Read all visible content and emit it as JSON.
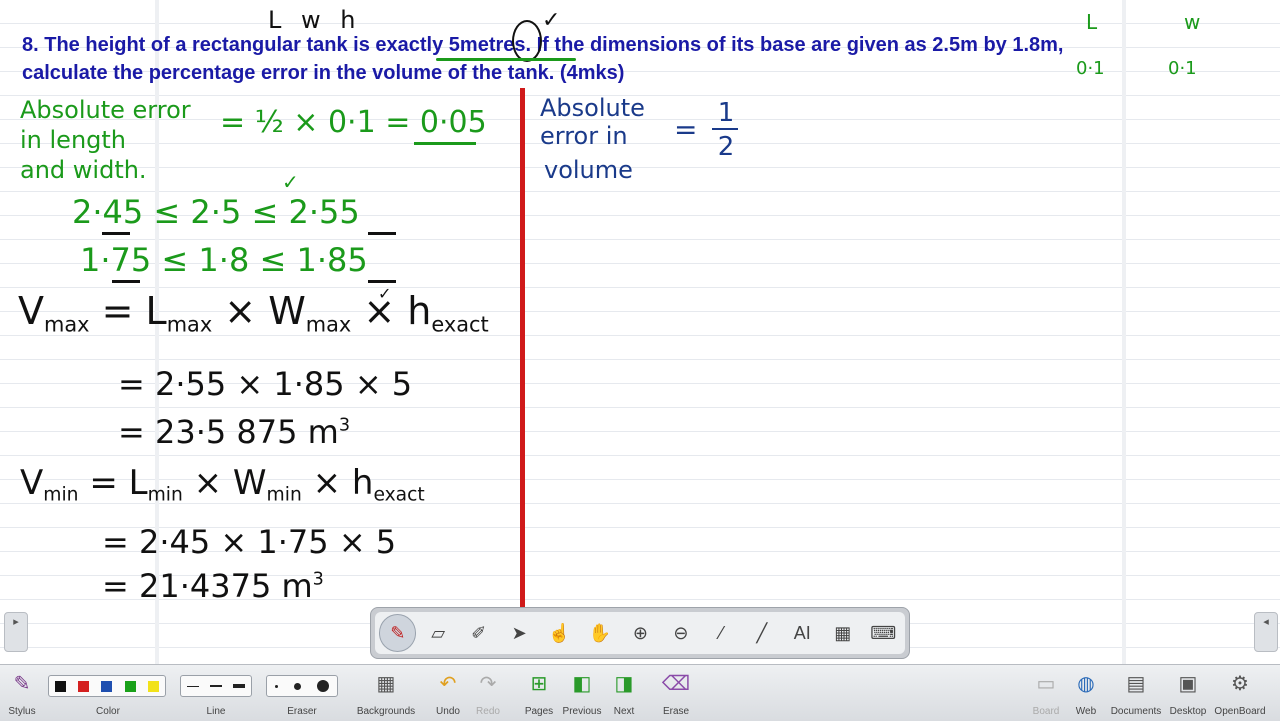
{
  "question": {
    "line1": "8. The height of a rectangular tank is exactly 5metres. If the dimensions of its base are given as 2.5m by 1.8m,",
    "line2": "calculate the percentage error in the volume of the tank. (4mks)"
  },
  "annotations": {
    "lwh": "L w h",
    "L": "L",
    "w": "w",
    "l_err": "0·1",
    "w_err": "0·1",
    "tick": "✓"
  },
  "left_work": {
    "abs_err_label_1": "Absolute error",
    "abs_err_label_2": "in length",
    "abs_err_label_3": "and width.",
    "abs_err_calc_a": "= ",
    "abs_err_half": "½",
    "abs_err_calc_b": " × 0·1 = 0·05",
    "bound_len": "2·45  ≤ 2·5 ≤ 2·55",
    "bound_wid": "1·75  ≤ 1·8 ≤ 1·85",
    "vmax_V": "V",
    "vmax_sub": "max",
    "vmax_eq": " = L",
    "vmax_Lsub": "max",
    "vmax_x1": " × W",
    "vmax_Wsub": "max",
    "vmax_x2": " × h",
    "vmax_hsub": "exact",
    "vmax_step1": "= 2·55 × 1·85 × 5",
    "vmax_step2": "= 23·5 875 m",
    "vmin_V": "V",
    "vmin_sub": "min",
    "vmin_eq": " = L",
    "vmin_Lsub": "min",
    "vmin_x1": " × W",
    "vmin_Wsub": "min",
    "vmin_x2": " × h",
    "vmin_hsub": "exact",
    "vmin_step1": "= 2·45 × 1·75 × 5",
    "vmin_step2": "= 21·4375 m",
    "cube": "3"
  },
  "right_work": {
    "label_1": "Absolute",
    "label_2": "error in",
    "label_3": "volume",
    "eq": "=",
    "num": "1",
    "den": "2"
  },
  "side_tabs": {
    "left": "▸",
    "right": "◂"
  },
  "colors": {
    "question": "#1a1aa6",
    "green_ink": "#1b9a1b",
    "black_ink": "#111111",
    "blue_ink": "#1a3a8a",
    "divider": "#d01a1a"
  },
  "floating_toolbar": {
    "tools": [
      {
        "icon": "pen-icon",
        "glyph": "✎"
      },
      {
        "icon": "eraser-icon",
        "glyph": "▱"
      },
      {
        "icon": "highlighter-icon",
        "glyph": "✐"
      },
      {
        "icon": "pointer-icon",
        "glyph": "➤"
      },
      {
        "icon": "laser-hand-icon",
        "glyph": "☝"
      },
      {
        "icon": "hand-icon",
        "glyph": "✋"
      },
      {
        "icon": "zoom-in-icon",
        "glyph": "⊕"
      },
      {
        "icon": "zoom-out-icon",
        "glyph": "⊖"
      },
      {
        "icon": "laser-pointer-icon",
        "glyph": "⁄"
      },
      {
        "icon": "line-icon",
        "glyph": "╱"
      },
      {
        "icon": "text-icon",
        "glyph": "AI"
      },
      {
        "icon": "capture-icon",
        "glyph": "▦"
      },
      {
        "icon": "keyboard-icon",
        "glyph": "⌨"
      }
    ]
  },
  "bottom_toolbar": {
    "stylus": "Stylus",
    "color": "Color",
    "line": "Line",
    "eraser": "Eraser",
    "backgrounds": "Backgrounds",
    "undo": "Undo",
    "redo": "Redo",
    "pages": "Pages",
    "previous": "Previous",
    "next": "Next",
    "erase": "Erase",
    "board": "Board",
    "web": "Web",
    "documents": "Documents",
    "desktop": "Desktop",
    "openboard": "OpenBoard",
    "palette": [
      "#111111",
      "#d42020",
      "#1f4fb0",
      "#1aa11a",
      "#f2e21a"
    ]
  }
}
